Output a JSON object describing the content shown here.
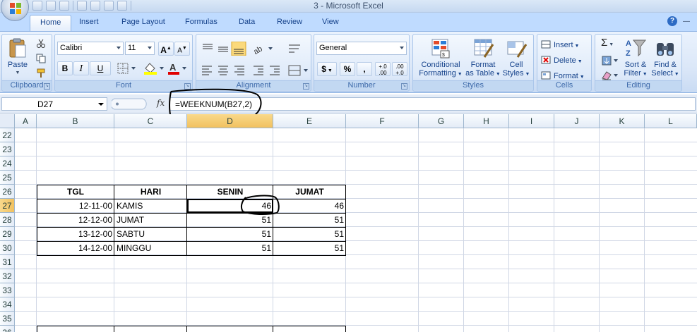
{
  "window": {
    "title": "3 - Microsoft Excel"
  },
  "ribbon_tabs": [
    "Home",
    "Insert",
    "Page Layout",
    "Formulas",
    "Data",
    "Review",
    "View"
  ],
  "clipboard": {
    "paste": "Paste",
    "label": "Clipboard"
  },
  "font": {
    "name": "Calibri",
    "size": "11",
    "bold": "B",
    "italic": "I",
    "underline": "U",
    "label": "Font"
  },
  "alignment": {
    "label": "Alignment"
  },
  "number": {
    "format": "General",
    "currency": "$",
    "percent": "%",
    "comma": ",",
    "increase_decimal": "+.0 .00",
    "decrease_decimal": ".00 +.0",
    "label": "Number"
  },
  "styles": {
    "conditional_1": "Conditional",
    "conditional_2": "Formatting",
    "format_table_1": "Format",
    "format_table_2": "as Table",
    "cell_styles_1": "Cell",
    "cell_styles_2": "Styles",
    "label": "Styles"
  },
  "cells": {
    "insert": "Insert",
    "delete": "Delete",
    "format": "Format",
    "label": "Cells"
  },
  "editing": {
    "sum": "Σ",
    "sort_1": "Sort &",
    "sort_2": "Filter",
    "find_1": "Find &",
    "find_2": "Select",
    "label": "Editing"
  },
  "formula_bar": {
    "name_box": "D27",
    "fx": "fx",
    "formula": "=WEEKNUM(B27,2)"
  },
  "sheet": {
    "columns": [
      "A",
      "B",
      "C",
      "D",
      "E",
      "F",
      "G",
      "H",
      "I",
      "J",
      "K",
      "L"
    ],
    "rows": [
      "22",
      "23",
      "24",
      "25",
      "26",
      "27",
      "28",
      "29",
      "30",
      "31",
      "32",
      "33",
      "34",
      "35",
      "36"
    ],
    "table_header": [
      "TGL",
      "HARI",
      "SENIN",
      "JUMAT"
    ],
    "table_rows": [
      [
        "12-11-00",
        "KAMIS",
        "46",
        "46"
      ],
      [
        "12-12-00",
        "JUMAT",
        "51",
        "51"
      ],
      [
        "13-12-00",
        "SABTU",
        "51",
        "51"
      ],
      [
        "14-12-00",
        "MINGGU",
        "51",
        "51"
      ]
    ]
  }
}
